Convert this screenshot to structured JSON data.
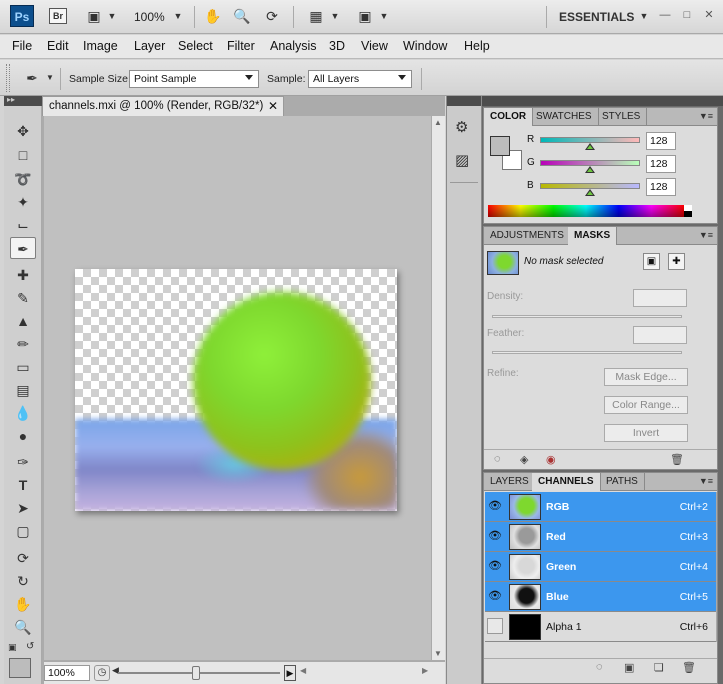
{
  "topbar": {
    "ps": "Ps",
    "br": "Br",
    "zoom": "100%",
    "workspace": "ESSENTIALS",
    "icons": [
      "hand-icon",
      "zoom-icon",
      "rotate-view-icon",
      "arrange-docs-icon",
      "screen-mode-icon"
    ]
  },
  "menu": [
    "File",
    "Edit",
    "Image",
    "Layer",
    "Select",
    "Filter",
    "Analysis",
    "3D",
    "View",
    "Window",
    "Help"
  ],
  "options": {
    "sample_size_label": "Sample Size:",
    "sample_size_value": "Point Sample",
    "sample_label": "Sample:",
    "sample_value": "All Layers"
  },
  "document": {
    "tab_title": "channels.mxi @ 100% (Render, RGB/32*)",
    "zoom": "100%"
  },
  "color_panel": {
    "tabs": [
      "COLOR",
      "SWATCHES",
      "STYLES"
    ],
    "r_label": "R",
    "g_label": "G",
    "b_label": "B",
    "r": "128",
    "g": "128",
    "b": "128"
  },
  "masks_panel": {
    "tabs": [
      "ADJUSTMENTS",
      "MASKS"
    ],
    "status": "No mask selected",
    "density_label": "Density:",
    "feather_label": "Feather:",
    "refine_label": "Refine:",
    "mask_edge": "Mask Edge...",
    "color_range": "Color Range...",
    "invert": "Invert"
  },
  "channels_panel": {
    "tabs": [
      "LAYERS",
      "CHANNELS",
      "PATHS"
    ],
    "channels": [
      {
        "name": "RGB",
        "shortcut": "Ctrl+2"
      },
      {
        "name": "Red",
        "shortcut": "Ctrl+3"
      },
      {
        "name": "Green",
        "shortcut": "Ctrl+4"
      },
      {
        "name": "Blue",
        "shortcut": "Ctrl+5"
      },
      {
        "name": "Alpha 1",
        "shortcut": "Ctrl+6"
      }
    ]
  },
  "colors": {
    "selection": "#3c97ee",
    "panel_bg": "#dcdcdc",
    "dark_header": "#4c4c4c"
  }
}
